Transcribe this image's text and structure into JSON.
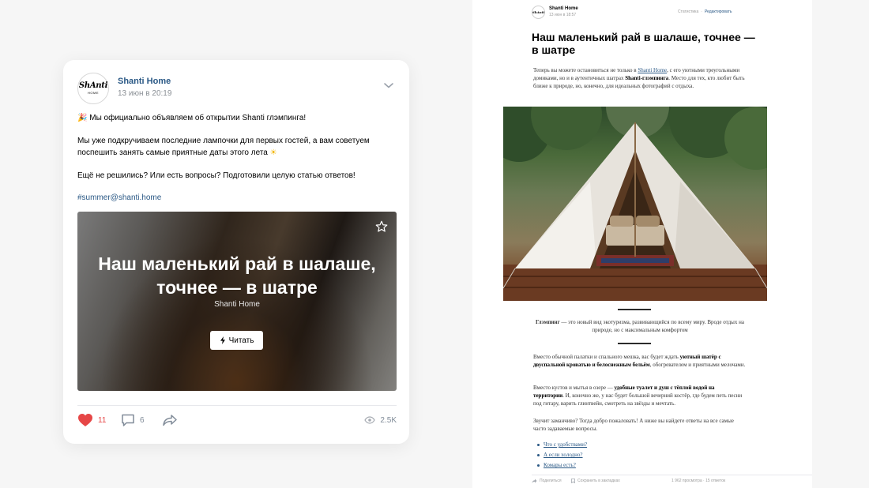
{
  "post": {
    "author": "Shanti Home",
    "date": "13 июн в 20:19",
    "avatar_logo": "ShAnti",
    "avatar_sub": "HOME",
    "paragraphs": [
      "Мы официально объявляем об открытии Shanti глэмпинга!",
      "Мы уже подкручиваем последние лампочки для первых гостей, а вам советуем поспешить занять самые приятные даты этого лета",
      "Ещё не решились? Или есть вопросы? Подготовили целую статью ответов!"
    ],
    "emoji_party": "🎉",
    "emoji_sun": "☀",
    "hashtag": "#summer@shanti.home",
    "snippet": {
      "title": "Наш маленький рай в шалаше, точнее — в шатре",
      "source": "Shanti Home",
      "read_label": "Читать"
    },
    "likes": "11",
    "comments": "6",
    "views": "2.5K",
    "colors": {
      "like": "#e64646",
      "link": "#2a5885",
      "muted": "#818c99"
    }
  },
  "article": {
    "author": "Shanti Home",
    "date": "13 июн в 18:57",
    "avatar_logo": "ShAnti",
    "stats_label": "Статистика",
    "edit_label": "Редактировать",
    "title": "Наш маленький рай в шалаше, точнее — в шатре",
    "intro": {
      "a": "Теперь вы можете остановиться не только в ",
      "link": "Shanti Home",
      "b": ", с его уютными треугольными домиками, но и в аутентичных шатрах ",
      "bold": "Shanti-глэмпинга",
      "c": ". Место для тех, кто любит быть ближе к природе, но, конечно, для идеальных фотографий с отдыха."
    },
    "quote": {
      "bold": "Глэмпинг",
      "text": " — это новый вид экотуризма, развивающийся по всему миру. Вроде отдых на природе, но с максимальным комфортом"
    },
    "p1": {
      "a": "Вместо обычной палатки и спального мешка, вас будет ждать ",
      "bold": "уютный шатёр с двуспальной кроватью и белоснежным бельём",
      "b": ", обогревателем и приятными мелочами."
    },
    "p2": {
      "a": "Вместо кустов и мытья в озере — ",
      "bold": "удобные туалет и душ с тёплой водой на территории",
      "b": ". И, конечно же, у нас будет большой вечерний костёр, где будем петь песни под гитару, варить глинтвейн, смотреть на звёзды и мечтать."
    },
    "p3": "Звучит заманчиво? Тогда добро пожаловать! А ниже вы найдете ответы на все самые часто задаваемые вопросы.",
    "faq": [
      "Что с удобствами?",
      "А если холодно?",
      "Комары есть?"
    ],
    "footer": {
      "share": "Поделиться",
      "save": "Сохранить в закладках",
      "stats": "1 962 просмотра · 15 отметок"
    }
  }
}
